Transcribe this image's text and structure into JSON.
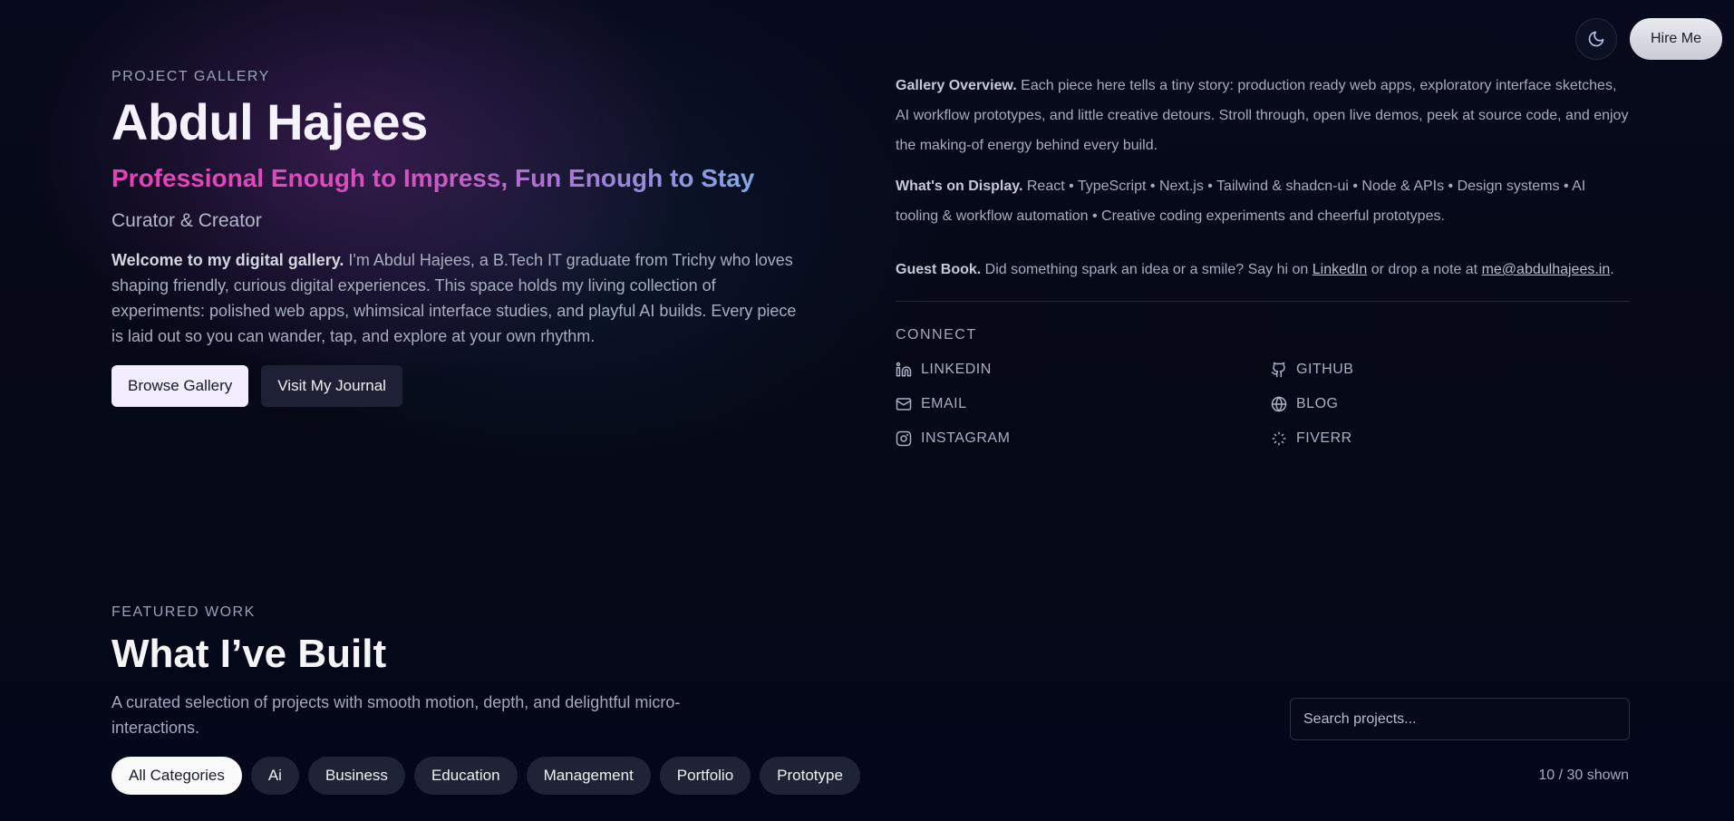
{
  "topbar": {
    "theme_icon": "moon-icon",
    "hire_label": "Hire Me"
  },
  "hero": {
    "eyebrow": "PROJECT GALLERY",
    "name": "Abdul Hajees",
    "tagline": "Professional Enough to Impress, Fun Enough to Stay",
    "role": "Curator & Creator",
    "intro_bold": "Welcome to my digital gallery.",
    "intro_text": " I'm Abdul Hajees, a B.Tech IT graduate from Trichy who loves shaping friendly, curious digital experiences. This space holds my living collection of experiments: polished web apps, whimsical interface studies, and playful AI builds. Every piece is laid out so you can wander, tap, and explore at your own rhythm.",
    "primary_cta": "Browse Gallery",
    "secondary_cta": "Visit My Journal"
  },
  "overview": {
    "gallery_bold": "Gallery Overview.",
    "gallery_text": " Each piece here tells a tiny story: production ready web apps, exploratory interface sketches, AI workflow prototypes, and little creative detours. Stroll through, open live demos, peek at source code, and enjoy the making-of energy behind every build.",
    "display_bold": "What's on Display.",
    "display_text": " React • TypeScript • Next.js • Tailwind & shadcn-ui • Node & APIs • Design systems • AI tooling & workflow automation • Creative coding experiments and cheerful prototypes.",
    "guest_bold": "Guest Book.",
    "guest_text_1": " Did something spark an idea or a smile? Say hi on ",
    "guest_link_linkedin": "LinkedIn",
    "guest_text_2": " or drop a note at ",
    "guest_link_email": "me@abdulhajees.in",
    "guest_text_3": "."
  },
  "connect": {
    "title": "CONNECT",
    "links": [
      {
        "label": "LINKEDIN",
        "icon": "linkedin-icon"
      },
      {
        "label": "GITHUB",
        "icon": "github-icon"
      },
      {
        "label": "EMAIL",
        "icon": "mail-icon"
      },
      {
        "label": "BLOG",
        "icon": "globe-icon"
      },
      {
        "label": "INSTAGRAM",
        "icon": "instagram-icon"
      },
      {
        "label": "FIVERR",
        "icon": "sparkle-icon"
      }
    ]
  },
  "featured": {
    "eyebrow": "FEATURED WORK",
    "title": "What I’ve Built",
    "description": "A curated selection of projects with smooth motion, depth, and delightful micro-interactions.",
    "search_placeholder": "Search projects...",
    "categories": [
      "All Categories",
      "Ai",
      "Business",
      "Education",
      "Management",
      "Portfolio",
      "Prototype"
    ],
    "active_category": "All Categories",
    "count_text": "10 / 30 shown"
  },
  "colors": {
    "tagline_start": "#ea3fb6",
    "tagline_end": "#80a8e6",
    "background": "#050815"
  }
}
